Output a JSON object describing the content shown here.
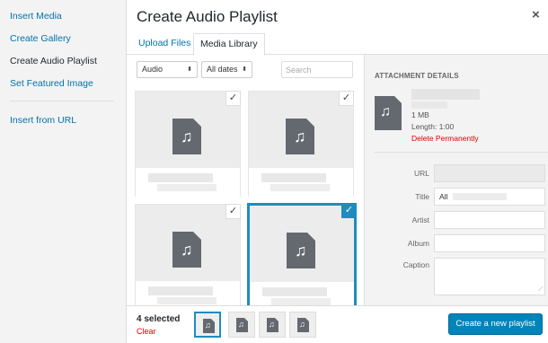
{
  "sidebar": {
    "items": [
      {
        "label": "Insert Media"
      },
      {
        "label": "Create Gallery"
      },
      {
        "label": "Create Audio Playlist"
      },
      {
        "label": "Set Featured Image"
      },
      {
        "label": "Insert from URL"
      }
    ],
    "active_item": "Create Audio Playlist"
  },
  "modal": {
    "title": "Create Audio Playlist",
    "close_icon": "close-icon",
    "close_glyph": "×"
  },
  "tabs": [
    {
      "label": "Upload Files"
    },
    {
      "label": "Media Library"
    }
  ],
  "active_tab": "Media Library",
  "filters": {
    "type_value": "Audio",
    "date_value": "All dates",
    "arrow_glyph": "⬍",
    "search_placeholder": "Search"
  },
  "icons": {
    "audio_file": "audio-file-icon",
    "music_note_glyph": "♫",
    "check_glyph": "✓",
    "resize_glyph": "⟋"
  },
  "attachments": [
    {
      "selected": true,
      "highlighted": false
    },
    {
      "selected": true,
      "highlighted": false
    },
    {
      "selected": true,
      "highlighted": false
    },
    {
      "selected": true,
      "highlighted": true
    }
  ],
  "details": {
    "heading": "ATTACHMENT DETAILS",
    "size": "1 MB",
    "length": "Length: 1:00",
    "delete_label": "Delete Permanently",
    "fields": {
      "url_label": "URL",
      "title_label": "Title",
      "title_value": "All",
      "artist_label": "Artist",
      "album_label": "Album",
      "caption_label": "Caption"
    }
  },
  "toolbar": {
    "selected_count": "4 selected",
    "clear_label": "Clear",
    "primary_button": "Create a new playlist"
  },
  "colors": {
    "accent": "#0073aa",
    "selection_blue": "#1e8cbe",
    "danger": "#dd0000",
    "primary_button": "#0085ba"
  }
}
